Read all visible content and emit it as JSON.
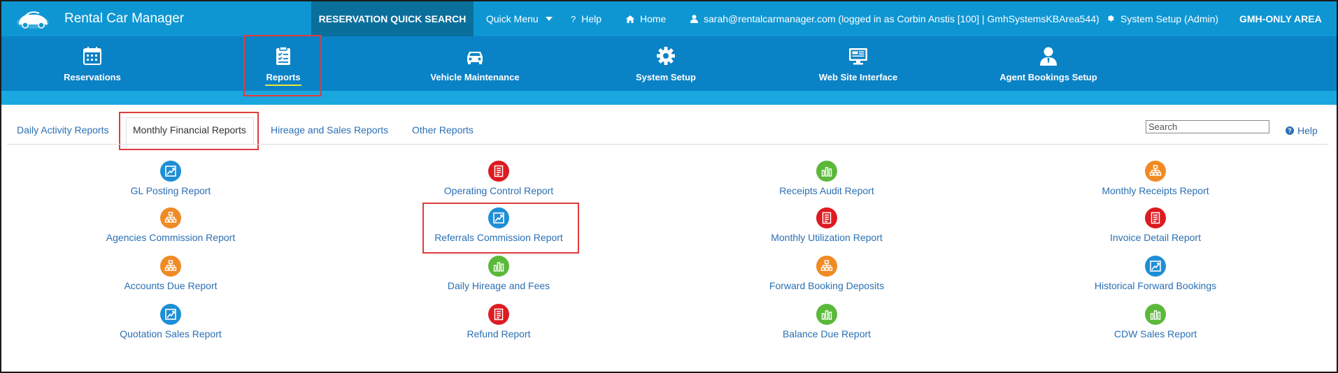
{
  "header": {
    "app_name": "Rental Car Manager",
    "quick_search": "RESERVATION QUICK SEARCH",
    "quick_menu": "Quick Menu",
    "help": "Help",
    "home": "Home",
    "user": "sarah@rentalcarmanager.com (logged in as Corbin Anstis [100] | GmhSystemsKBArea544)",
    "system_setup": "System Setup (Admin)",
    "gmh_area": "GMH-ONLY AREA"
  },
  "modules": [
    {
      "label": "Reservations",
      "icon": "calendar-icon"
    },
    {
      "label": "Reports",
      "icon": "clipboard-checklist-icon",
      "active": true
    },
    {
      "label": "Vehicle Maintenance",
      "icon": "car-icon"
    },
    {
      "label": "System Setup",
      "icon": "gear-icon"
    },
    {
      "label": "Web Site Interface",
      "icon": "monitor-icon"
    },
    {
      "label": "Agent Bookings Setup",
      "icon": "agent-user-icon"
    }
  ],
  "tabs": [
    {
      "label": "Daily Activity Reports"
    },
    {
      "label": "Monthly Financial Reports",
      "active": true
    },
    {
      "label": "Hireage and Sales Reports"
    },
    {
      "label": "Other Reports"
    }
  ],
  "search": {
    "placeholder": "Search"
  },
  "help_label": "Help",
  "colors": {
    "topbar": "#0e96d3",
    "quick_search_bg": "#0b6f9c",
    "module_bar": "#0a82c6",
    "link": "#2a6fb3",
    "highlight": "#e03b3b",
    "icon_blue": "#1e8fd6",
    "icon_red": "#dd1b20",
    "icon_green": "#5cb83b",
    "icon_orange": "#f08a24"
  },
  "reports": [
    [
      {
        "label": "GL Posting Report",
        "color": "blue",
        "icon": "trend-chart-icon"
      },
      {
        "label": "Agencies Commission Report",
        "color": "orange",
        "icon": "org-chart-icon"
      },
      {
        "label": "Accounts Due Report",
        "color": "orange",
        "icon": "org-chart-icon"
      },
      {
        "label": "Quotation Sales Report",
        "color": "blue",
        "icon": "trend-chart-icon"
      }
    ],
    [
      {
        "label": "Operating Control Report",
        "color": "red",
        "icon": "document-icon"
      },
      {
        "label": "Referrals Commission Report",
        "color": "blue",
        "icon": "trend-chart-icon"
      },
      {
        "label": "Daily Hireage and Fees",
        "color": "green",
        "icon": "bar-chart-icon"
      },
      {
        "label": "Refund Report",
        "color": "red",
        "icon": "document-icon"
      }
    ],
    [
      {
        "label": "Receipts Audit Report",
        "color": "green",
        "icon": "bar-chart-icon"
      },
      {
        "label": "Monthly Utilization Report",
        "color": "red",
        "icon": "document-icon"
      },
      {
        "label": "Forward Booking Deposits",
        "color": "orange",
        "icon": "org-chart-icon"
      },
      {
        "label": "Balance Due Report",
        "color": "green",
        "icon": "bar-chart-icon"
      }
    ],
    [
      {
        "label": "Monthly Receipts Report",
        "color": "orange",
        "icon": "org-chart-icon"
      },
      {
        "label": "Invoice Detail Report",
        "color": "red",
        "icon": "document-icon"
      },
      {
        "label": "Historical Forward Bookings",
        "color": "blue",
        "icon": "trend-chart-icon"
      },
      {
        "label": "CDW Sales Report",
        "color": "green",
        "icon": "bar-chart-icon"
      }
    ]
  ]
}
